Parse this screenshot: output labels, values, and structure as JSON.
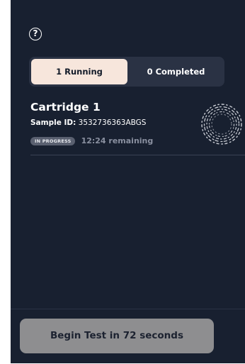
{
  "help": {
    "glyph": "?"
  },
  "tabs": [
    {
      "label": "1 Running",
      "active": true
    },
    {
      "label": "0 Completed",
      "active": false
    }
  ],
  "cartridge": {
    "title": "Cartridge 1",
    "sample_label": "Sample ID:",
    "sample_id": "3532736363ABGS",
    "status_badge": "IN PROGRESS",
    "remaining": "12:24 remaining",
    "spinner_icon": "dna-ring-spinner-icon"
  },
  "begin_button": {
    "label": "Begin Test in 72 seconds",
    "disabled": true
  },
  "colors": {
    "panel_bg": "#182030",
    "active_tab_bg": "#f7e6dc",
    "button_bg": "#8e8e90",
    "badge_bg": "#5a6070"
  }
}
